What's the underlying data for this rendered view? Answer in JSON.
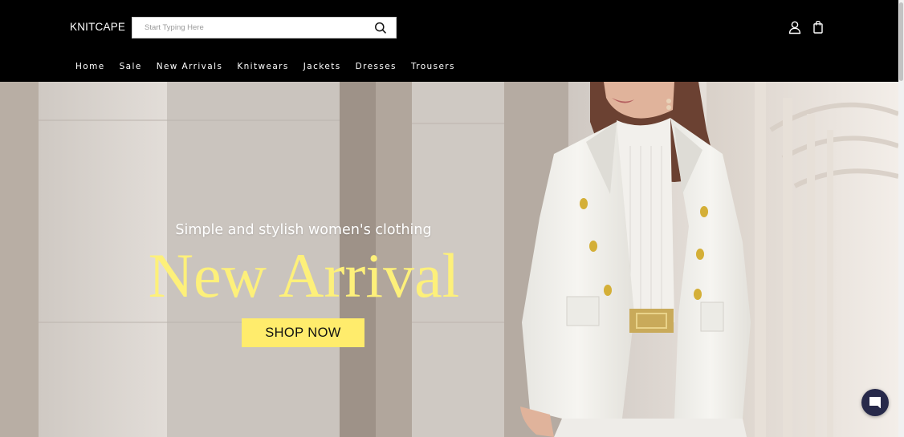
{
  "brand": {
    "logo_text": "KNITCAPE"
  },
  "search": {
    "placeholder": "Start Typing Here",
    "value": "",
    "button_icon": "search-icon"
  },
  "header_actions": {
    "account_icon": "user-icon",
    "cart_icon": "shopping-bag-icon"
  },
  "nav": {
    "items": [
      {
        "label": "Home"
      },
      {
        "label": "Sale"
      },
      {
        "label": "New Arrivals"
      },
      {
        "label": "Knitwears"
      },
      {
        "label": "Jackets"
      },
      {
        "label": "Dresses"
      },
      {
        "label": "Trousers"
      }
    ]
  },
  "hero": {
    "subtitle": "Simple and stylish women's clothing",
    "title": "New Arrival",
    "cta_label": "SHOP NOW",
    "image_subject": "woman in white double-breasted blazer with gold buttons, white turtleneck and gold belt",
    "colors": {
      "title": "#fdf07a",
      "cta_background": "#ffec6c",
      "subtitle": "#ffffff"
    }
  },
  "chat": {
    "icon": "chat-bubble-icon",
    "color": "#27294a"
  },
  "colors": {
    "header_background": "#000000",
    "header_text": "#ffffff"
  }
}
